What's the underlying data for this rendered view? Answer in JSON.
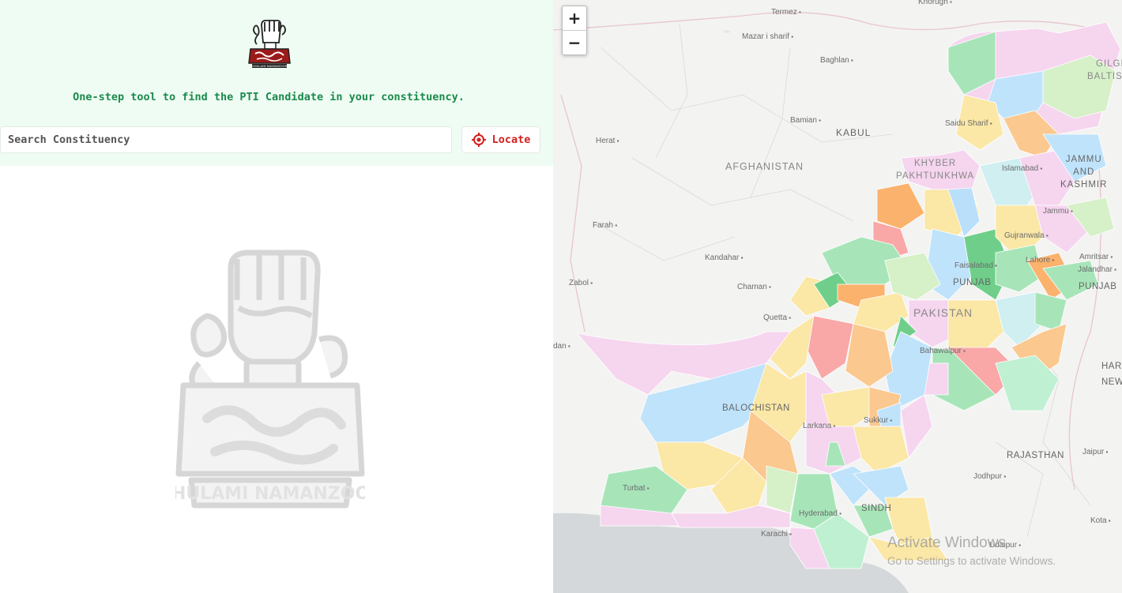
{
  "header": {
    "tagline": "One-step tool to find the PTI Candidate in your constituency.",
    "logo_caption": "GHULAMI NAMANZOOR"
  },
  "search": {
    "placeholder": "Search Constituency",
    "value": ""
  },
  "locate_button": {
    "label": "Locate",
    "icon": "crosshair-icon",
    "color": "#d32020"
  },
  "watermark_logo": {
    "caption": "GHULAMI NAMANZOOR"
  },
  "map": {
    "zoom_in_label": "+",
    "zoom_out_label": "−",
    "cities": {
      "termez": "Termez",
      "khorugh": "Khorugh",
      "mazar": "Mazar i sharif",
      "baghlan": "Baghlan",
      "herat": "Herat",
      "bamian": "Bamian",
      "kabul": "KABUL",
      "saidu": "Saidu Sharif",
      "islamabad": "Islamabad",
      "jammu": "Jammu",
      "farah": "Farah",
      "gujranwala": "Gujranwala",
      "kandahar": "Kandahar",
      "amritsar": "Amritsar",
      "jalandhar": "Jalandhar",
      "faisalabad": "Faisalabad",
      "lahore": "Lahore",
      "zabol": "Zabol",
      "chaman": "Chaman",
      "quetta": "Quetta",
      "bahawalpur": "Bahawalpur",
      "larkana": "Larkana",
      "sukkur": "Sukkur",
      "jaipur": "Jaipur",
      "jodhpur": "Jodhpur",
      "turbat": "Turbat",
      "hyderabad": "Hyderabad",
      "kota": "Kota",
      "karachi": "Karachi",
      "udaipur": "Udaipur",
      "zahedan": "dan"
    },
    "labels": {
      "afghanistan": "AFGHANISTAN",
      "gilgit": "GILGIT-\nBALTISTAN",
      "kp": "KHYBER\nPAKHTUNKHWA",
      "jk": "JAMMU\nAND\nKASHMIR",
      "punjab_pk": "PUNJAB",
      "pakistan": "PAKISTAN",
      "punjab_in": "PUNJAB",
      "balochistan": "BALOCHISTAN",
      "haryana": "HARYA",
      "newdelhi": "NEW",
      "rajasthan": "RAJASTHAN",
      "sindh": "SINDH"
    }
  },
  "os_watermark": {
    "title": "Activate Windows",
    "subtitle": "Go to Settings to activate Windows."
  }
}
